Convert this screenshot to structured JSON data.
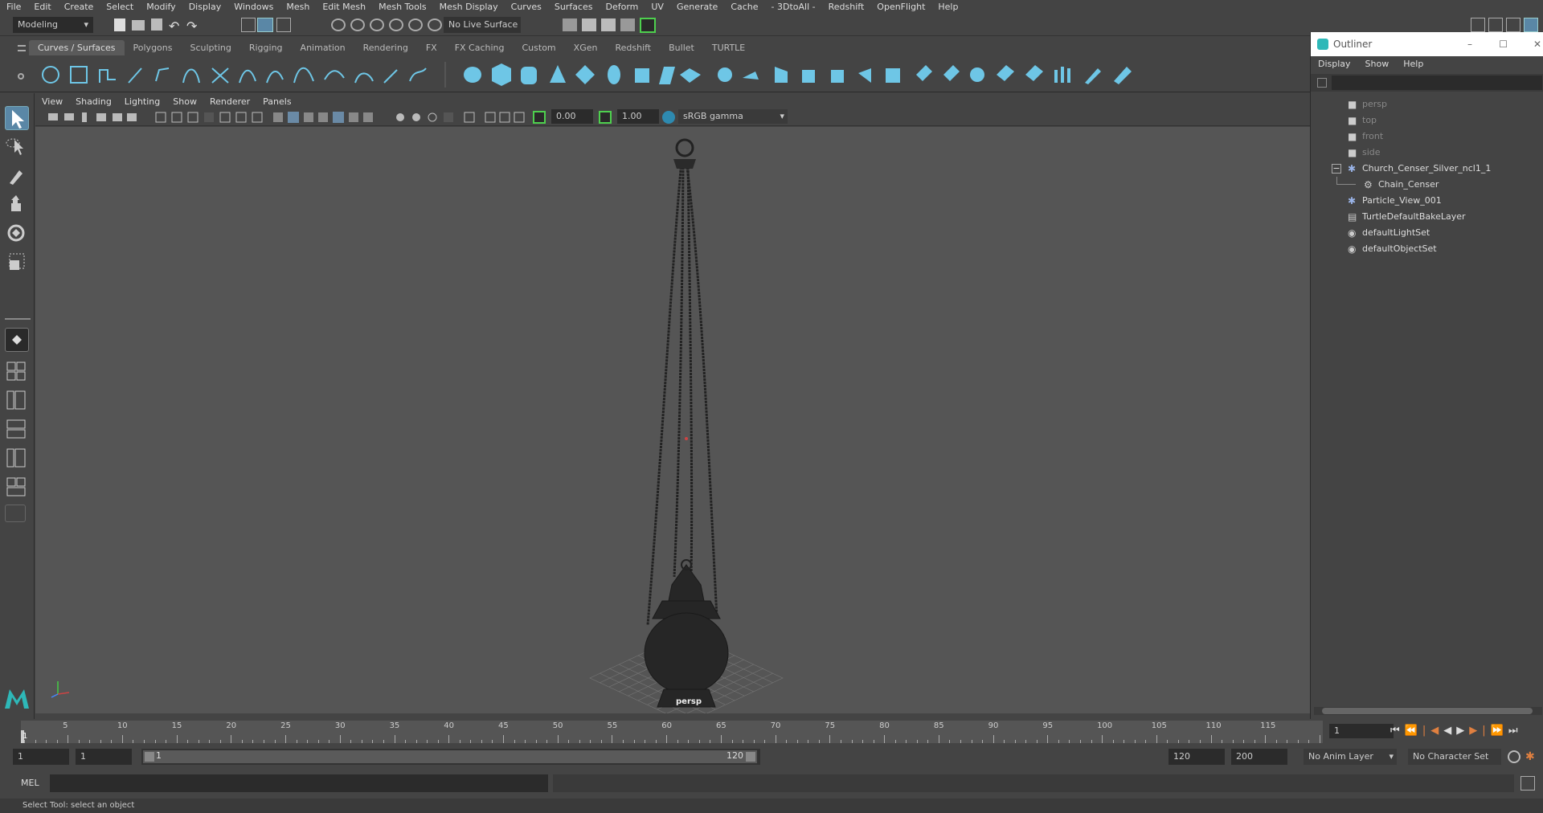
{
  "menubar": {
    "items": [
      "File",
      "Edit",
      "Create",
      "Select",
      "Modify",
      "Display",
      "Windows",
      "Mesh",
      "Edit Mesh",
      "Mesh Tools",
      "Mesh Display",
      "Curves",
      "Surfaces",
      "Deform",
      "UV",
      "Generate",
      "Cache",
      "- 3DtoAll -",
      "Redshift",
      "OpenFlight",
      "Help"
    ]
  },
  "statusline": {
    "mode": "Modeling",
    "live_surface": "No Live Surface"
  },
  "shelf": {
    "tabs": [
      "Curves / Surfaces",
      "Polygons",
      "Sculpting",
      "Rigging",
      "Animation",
      "Rendering",
      "FX",
      "FX Caching",
      "Custom",
      "XGen",
      "Redshift",
      "Bullet",
      "TURTLE"
    ],
    "active_tab": "Curves / Surfaces"
  },
  "panel": {
    "menus": [
      "View",
      "Shading",
      "Lighting",
      "Show",
      "Renderer",
      "Panels"
    ],
    "exposure": "0.00",
    "gamma": "1.00",
    "color_space": "sRGB gamma",
    "camera_label": "persp"
  },
  "outliner": {
    "title": "Outliner",
    "menus": [
      "Display",
      "Show",
      "Help"
    ],
    "items": [
      {
        "label": "persp",
        "icon": "camera-icon",
        "indent": 0,
        "dim": true
      },
      {
        "label": "top",
        "icon": "camera-icon",
        "indent": 0,
        "dim": true
      },
      {
        "label": "front",
        "icon": "camera-icon",
        "indent": 0,
        "dim": true
      },
      {
        "label": "side",
        "icon": "camera-icon",
        "indent": 0,
        "dim": true
      },
      {
        "label": "Church_Censer_Silver_ncl1_1",
        "icon": "transform-icon",
        "indent": 0,
        "dim": false,
        "expanded": true
      },
      {
        "label": "Chain_Censer",
        "icon": "mesh-group-icon",
        "indent": 1,
        "dim": false
      },
      {
        "label": "Particle_View_001",
        "icon": "transform-icon",
        "indent": 0,
        "dim": false
      },
      {
        "label": "TurtleDefaultBakeLayer",
        "icon": "layer-icon",
        "indent": 0,
        "dim": false
      },
      {
        "label": "defaultLightSet",
        "icon": "set-icon",
        "indent": 0,
        "dim": false
      },
      {
        "label": "defaultObjectSet",
        "icon": "set-icon",
        "indent": 0,
        "dim": false
      }
    ]
  },
  "timeline": {
    "ticks": [
      "5",
      "10",
      "15",
      "20",
      "25",
      "30",
      "35",
      "40",
      "45",
      "50",
      "55",
      "60",
      "65",
      "70",
      "75",
      "80",
      "85",
      "90",
      "95",
      "100",
      "105",
      "110",
      "115"
    ],
    "start_marker": "1",
    "current_frame": "1"
  },
  "range": {
    "start": "1",
    "anim_start": "1",
    "range_start_label": "1",
    "range_end_label": "120",
    "anim_end": "120",
    "end": "200",
    "anim_layer": "No Anim Layer",
    "character_set": "No Character Set"
  },
  "cmdline": {
    "lang": "MEL"
  },
  "helpline": {
    "text": "Select Tool: select an object"
  },
  "colors": {
    "accent": "#6ec6e6",
    "viewport_bg": "#555555",
    "ui_bg": "#444444"
  }
}
